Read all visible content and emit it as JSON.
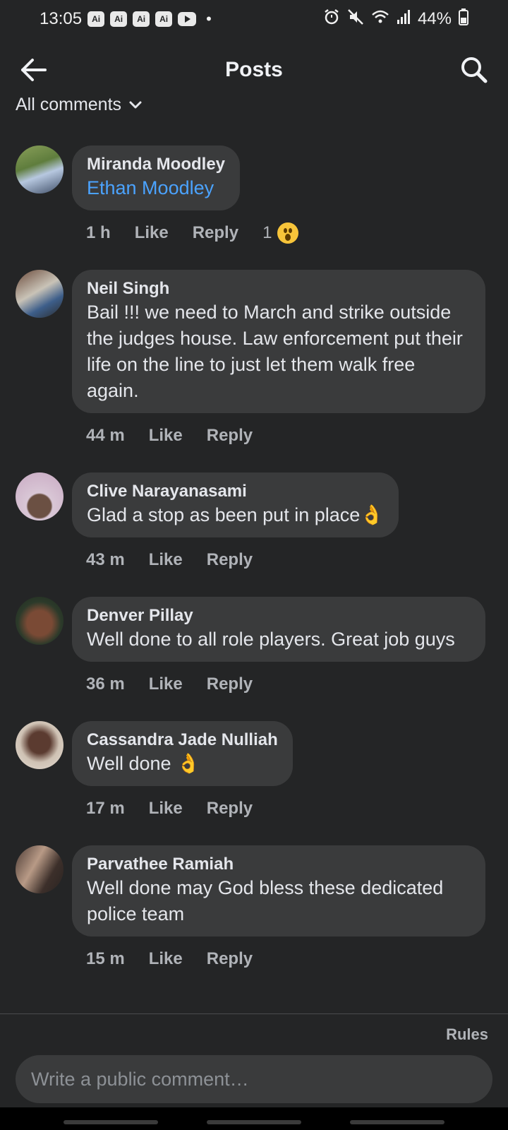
{
  "status": {
    "time": "13:05",
    "ai_badges": [
      "Ai",
      "Ai",
      "Ai",
      "Ai"
    ],
    "battery": "44%"
  },
  "header": {
    "title": "Posts",
    "back_icon": "arrow-left-icon",
    "search_icon": "search-icon"
  },
  "filter": {
    "label": "All comments"
  },
  "comments": [
    {
      "name": "Miranda Moodley",
      "tag": "Ethan Moodley",
      "time": "1 h",
      "like": "Like",
      "reply": "Reply",
      "reaction_count": "1"
    },
    {
      "name": "Neil Singh",
      "text": "Bail !!! we need to March and strike outside the judges house. Law enforcement put their life on the line to just let them walk free again.",
      "time": "44 m",
      "like": "Like",
      "reply": "Reply"
    },
    {
      "name": "Clive Narayanasami",
      "text": "Glad a stop as been put in place👌",
      "time": "43 m",
      "like": "Like",
      "reply": "Reply"
    },
    {
      "name": "Denver Pillay",
      "text": "Well done to all role players. Great job guys",
      "time": "36 m",
      "like": "Like",
      "reply": "Reply"
    },
    {
      "name": "Cassandra Jade Nulliah",
      "text": "Well done 👌",
      "time": "17 m",
      "like": "Like",
      "reply": "Reply"
    },
    {
      "name": "Parvathee Ramiah",
      "text": "Well done may God bless these dedicated  police team",
      "time": "15 m",
      "like": "Like",
      "reply": "Reply"
    }
  ],
  "footer": {
    "rules": "Rules",
    "input_placeholder": "Write a public comment…"
  }
}
